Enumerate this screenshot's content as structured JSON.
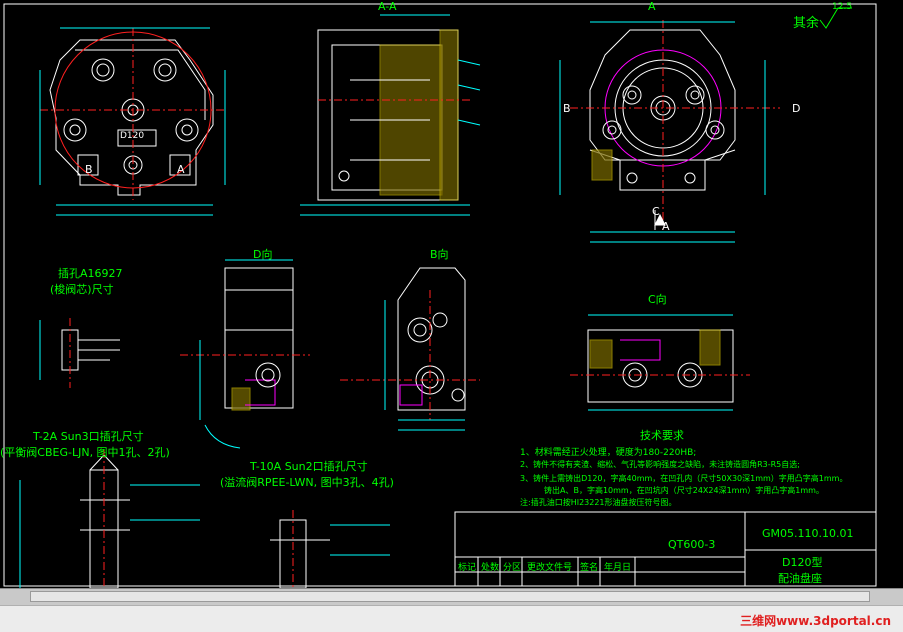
{
  "labels": {
    "top_section_a": "A-A",
    "top_section_a_right": "A",
    "rest_roughness": "其余",
    "roughness_value": "12.5",
    "view_b_side": "B",
    "view_d_side": "D",
    "view_c_arrow": "C",
    "view_a_arrow": "A",
    "port_b": "B",
    "port_a": "A",
    "model_box": "D120",
    "view_d_title": "D向",
    "view_b_title": "B向",
    "view_c_title": "C向",
    "insert_title_1": "插孔A16927",
    "insert_title_2": "(梭阀芯)尺寸",
    "t2a_title": "T-2A Sun3口插孔尺寸",
    "t2a_sub": "(平衡阀CBEG-LJN, 图中1孔、2孔)",
    "t10a_title": "T-10A Sun2口插孔尺寸",
    "t10a_sub": "(溢流阀RPEE-LWN, 图中3孔、4孔)",
    "tech_title": "技术要求",
    "tech_1": "1、材料需经正火处理，硬度为180-220HB;",
    "tech_2": "2、铸件不得有夹渣、缩松、气孔等影响强度之缺陷，未注铸造圆角R3-R5自选;",
    "tech_3": "3、铸件上需铸出D120，字高40mm，在凹孔内（尺寸50X30深1mm）字用凸字高1mm。",
    "tech_3b": "铸出A、B，字高10mm，在凹坑内（尺寸24X24深1mm）字用凸字高1mm。",
    "tech_note": "注:插孔油口按HI23221形油盘按压符号图。"
  },
  "title_block": {
    "part_code": "QT600-3",
    "drawing_no": "GM05.110.10.01",
    "name_line1": "D120型",
    "name_line2": "配油盘座",
    "h_mark": "标记",
    "h_count": "处数",
    "h_zone": "分区",
    "h_doc": "更改文件号",
    "h_sign": "签名",
    "h_date": "年月日"
  },
  "watermark": "三维网www.3dportal.cn",
  "colors": {
    "background": "#000000",
    "lines": "#ffffff",
    "centerline": "#ff2020",
    "dimension": "#00ffff",
    "text": "#00ff00",
    "hatch": "#c8b400",
    "hidden": "#ff00ff",
    "frame": "#ffffff"
  }
}
